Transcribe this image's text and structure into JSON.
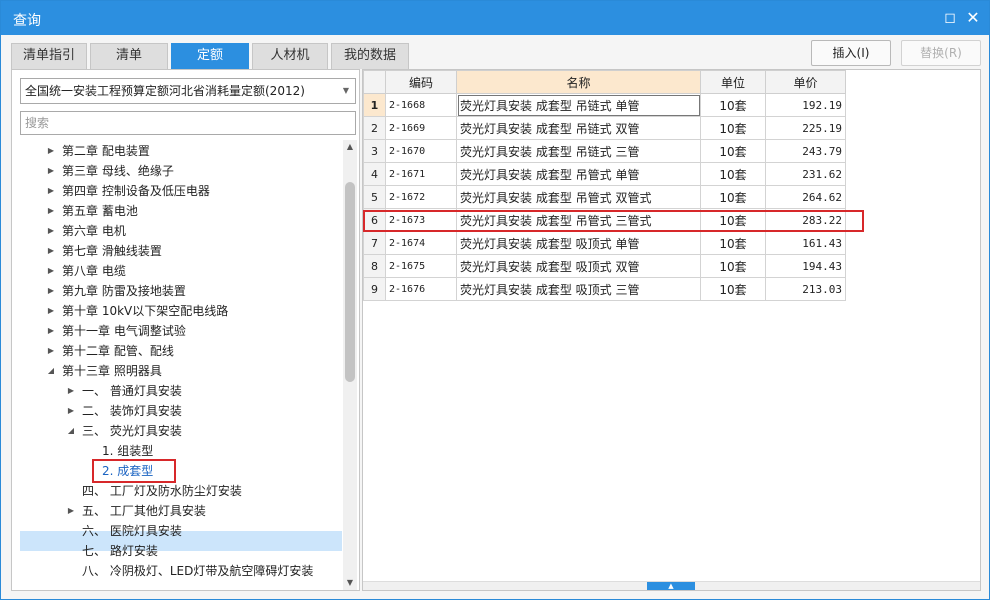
{
  "window": {
    "title": "查询",
    "maximize_icon": "maximize-icon",
    "close_icon": "close-icon",
    "accent": "#2c8fe0"
  },
  "tabs": [
    {
      "label": "清单指引",
      "active": false
    },
    {
      "label": "清单",
      "active": false
    },
    {
      "label": "定额",
      "active": true
    },
    {
      "label": "人材机",
      "active": false
    },
    {
      "label": "我的数据",
      "active": false
    }
  ],
  "actions": {
    "insert_label": "插入(I)",
    "replace_label": "替换(R)"
  },
  "left": {
    "selected_library": "全国统一安装工程预算定额河北省消耗量定额(2012)",
    "search_placeholder": "搜索",
    "tree": [
      {
        "label": "第二章 配电装置",
        "level": 0,
        "arrow": "collapsed"
      },
      {
        "label": "第三章 母线、绝缘子",
        "level": 0,
        "arrow": "collapsed"
      },
      {
        "label": "第四章 控制设备及低压电器",
        "level": 0,
        "arrow": "collapsed"
      },
      {
        "label": "第五章 蓄电池",
        "level": 0,
        "arrow": "collapsed"
      },
      {
        "label": "第六章 电机",
        "level": 0,
        "arrow": "collapsed"
      },
      {
        "label": "第七章 滑触线装置",
        "level": 0,
        "arrow": "collapsed"
      },
      {
        "label": "第八章 电缆",
        "level": 0,
        "arrow": "collapsed"
      },
      {
        "label": "第九章 防雷及接地装置",
        "level": 0,
        "arrow": "collapsed"
      },
      {
        "label": "第十章 10kV以下架空配电线路",
        "level": 0,
        "arrow": "collapsed"
      },
      {
        "label": "第十一章 电气调整试验",
        "level": 0,
        "arrow": "collapsed"
      },
      {
        "label": "第十二章 配管、配线",
        "level": 0,
        "arrow": "collapsed"
      },
      {
        "label": "第十三章 照明器具",
        "level": 0,
        "arrow": "expanded"
      },
      {
        "label": "一、 普通灯具安装",
        "level": 1,
        "arrow": "collapsed"
      },
      {
        "label": "二、 装饰灯具安装",
        "level": 1,
        "arrow": "collapsed"
      },
      {
        "label": "三、 荧光灯具安装",
        "level": 1,
        "arrow": "expanded"
      },
      {
        "label": "1. 组装型",
        "level": 2,
        "arrow": "none"
      },
      {
        "label": "2. 成套型",
        "level": 2,
        "arrow": "none",
        "selected": true
      },
      {
        "label": "四、 工厂灯及防水防尘灯安装",
        "level": 1,
        "arrow": "none"
      },
      {
        "label": "五、 工厂其他灯具安装",
        "level": 1,
        "arrow": "collapsed"
      },
      {
        "label": "六、 医院灯具安装",
        "level": 1,
        "arrow": "none"
      },
      {
        "label": "七、 路灯安装",
        "level": 1,
        "arrow": "none"
      },
      {
        "label": "八、 冷阴极灯、LED灯带及航空障碍灯安装",
        "level": 1,
        "arrow": "none"
      }
    ]
  },
  "grid": {
    "columns": [
      "编码",
      "名称",
      "单位",
      "单价"
    ],
    "rows": [
      {
        "num": "1",
        "code": "2-1668",
        "name": "荧光灯具安装 成套型 吊链式 单管",
        "unit": "10套",
        "price": "192.19"
      },
      {
        "num": "2",
        "code": "2-1669",
        "name": "荧光灯具安装 成套型 吊链式 双管",
        "unit": "10套",
        "price": "225.19"
      },
      {
        "num": "3",
        "code": "2-1670",
        "name": "荧光灯具安装 成套型 吊链式 三管",
        "unit": "10套",
        "price": "243.79"
      },
      {
        "num": "4",
        "code": "2-1671",
        "name": "荧光灯具安装 成套型 吊管式 单管",
        "unit": "10套",
        "price": "231.62"
      },
      {
        "num": "5",
        "code": "2-1672",
        "name": "荧光灯具安装 成套型 吊管式 双管式",
        "unit": "10套",
        "price": "264.62"
      },
      {
        "num": "6",
        "code": "2-1673",
        "name": "荧光灯具安装 成套型 吊管式 三管式",
        "unit": "10套",
        "price": "283.22"
      },
      {
        "num": "7",
        "code": "2-1674",
        "name": "荧光灯具安装 成套型 吸顶式 单管",
        "unit": "10套",
        "price": "161.43"
      },
      {
        "num": "8",
        "code": "2-1675",
        "name": "荧光灯具安装 成套型 吸顶式 双管",
        "unit": "10套",
        "price": "194.43"
      },
      {
        "num": "9",
        "code": "2-1676",
        "name": "荧光灯具安装 成套型 吸顶式 三管",
        "unit": "10套",
        "price": "213.03"
      }
    ]
  }
}
